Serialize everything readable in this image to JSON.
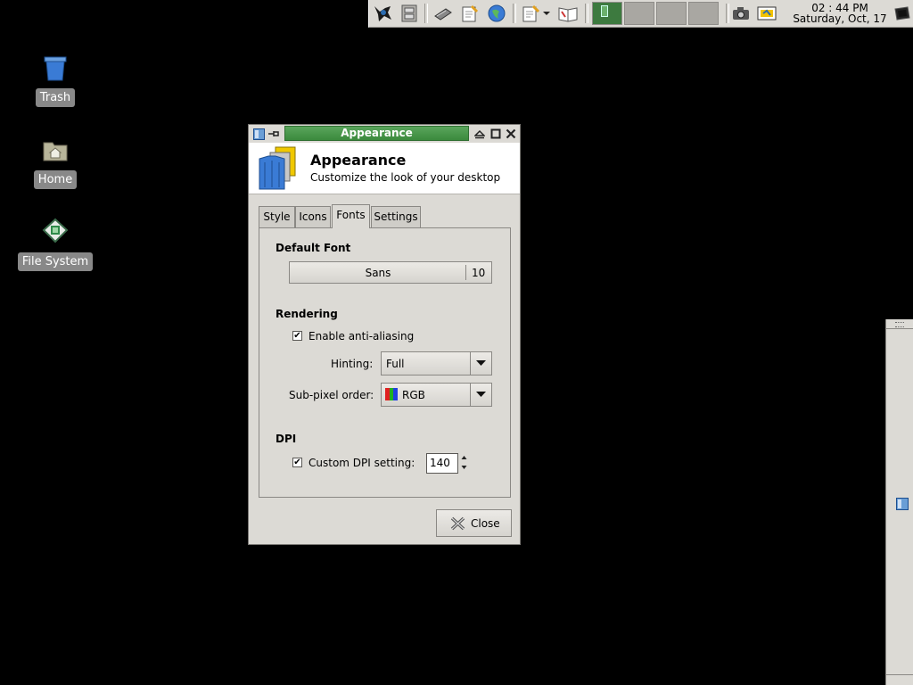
{
  "panel": {
    "clock_time": "02 : 44 PM",
    "clock_date": "Saturday, Oct, 17"
  },
  "desktop": {
    "icons": [
      {
        "label": "Trash"
      },
      {
        "label": "Home"
      },
      {
        "label": "File System"
      }
    ]
  },
  "window": {
    "title": "Appearance",
    "header_title": "Appearance",
    "header_subtitle": "Customize the look of your desktop",
    "tabs": [
      {
        "label": "Style"
      },
      {
        "label": "Icons"
      },
      {
        "label": "Fonts"
      },
      {
        "label": "Settings"
      }
    ],
    "active_tab": "Fonts",
    "default_font_section": "Default Font",
    "font_name": "Sans",
    "font_size": "10",
    "rendering_section": "Rendering",
    "antialias_label": "Enable anti-aliasing",
    "antialias_checked": true,
    "hinting_label": "Hinting:",
    "hinting_value": "Full",
    "subpixel_label": "Sub-pixel order:",
    "subpixel_value": "RGB",
    "dpi_section": "DPI",
    "custom_dpi_label": "Custom DPI setting:",
    "custom_dpi_checked": true,
    "dpi_value": "140",
    "close_label": "Close"
  },
  "colors": {
    "title_active": "#3b8a3d",
    "workspace_active": "#3d7a3f",
    "desktop_bg": "#000000"
  }
}
